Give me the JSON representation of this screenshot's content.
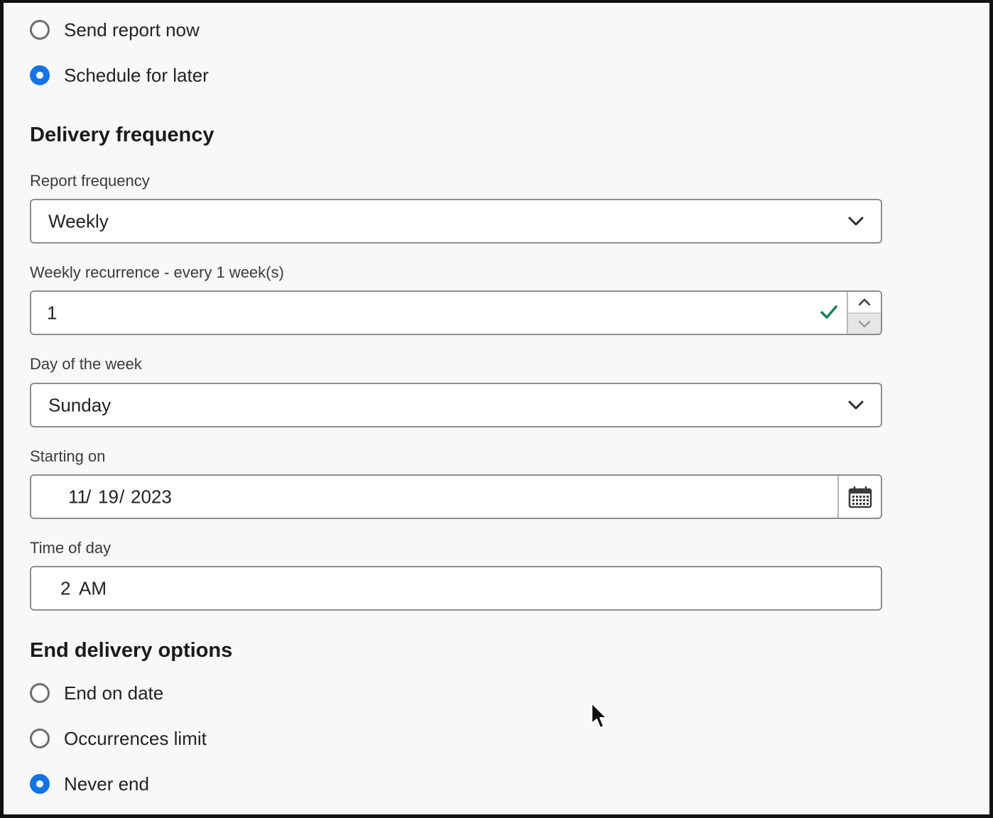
{
  "schedule_mode": {
    "options": [
      {
        "label": "Send report now",
        "checked": false
      },
      {
        "label": "Schedule for later",
        "checked": true
      }
    ]
  },
  "delivery_frequency": {
    "heading": "Delivery frequency",
    "report_frequency": {
      "label": "Report frequency",
      "value": "Weekly"
    },
    "weekly_recurrence": {
      "label": "Weekly recurrence - every 1 week(s)",
      "value": "1"
    },
    "day_of_week": {
      "label": "Day of the week",
      "value": "Sunday"
    },
    "starting_on": {
      "label": "Starting on",
      "month": "11",
      "day": "19",
      "year": "2023",
      "separator": "/"
    },
    "time_of_day": {
      "label": "Time of day",
      "hour": "2",
      "period": "AM"
    }
  },
  "end_delivery": {
    "heading": "End delivery options",
    "options": [
      {
        "label": "End on date",
        "checked": false
      },
      {
        "label": "Occurrences limit",
        "checked": false
      },
      {
        "label": "Never end",
        "checked": true
      }
    ]
  },
  "colors": {
    "accent": "#1473e6",
    "valid": "#12805c",
    "border": "#8e8e8e",
    "background": "#f8f8f8"
  },
  "icons": {
    "dropdown": "chevron-down-icon",
    "valid": "checkmark-icon",
    "step_up": "chevron-up-icon",
    "step_down": "chevron-down-icon",
    "date_picker": "calendar-icon",
    "pointer": "mouse-cursor-icon"
  }
}
